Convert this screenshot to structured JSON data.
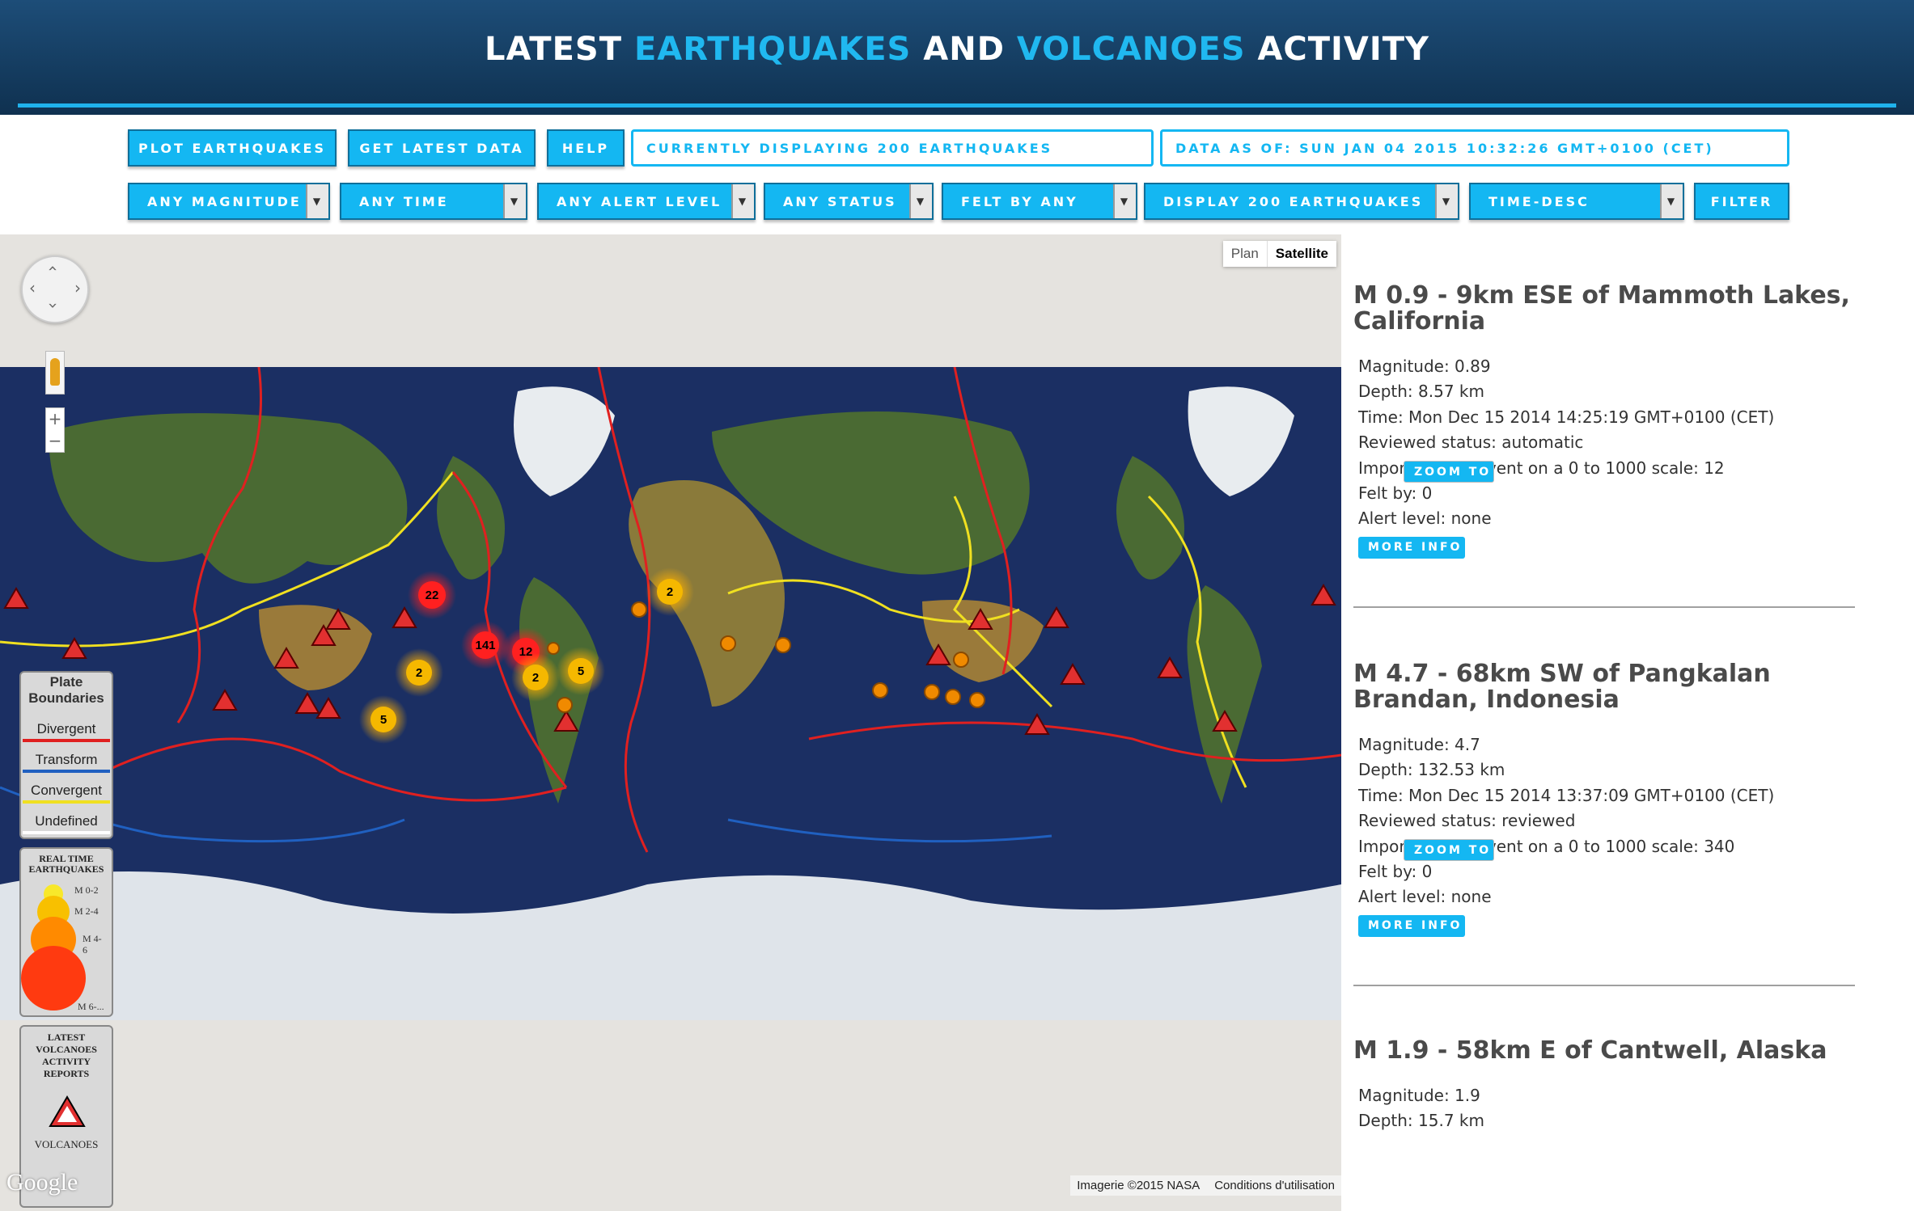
{
  "header": {
    "title_part1": "LATEST",
    "title_part2": "EARTHQUAKES",
    "title_part3": "AND",
    "title_part4": "VOLCANOES",
    "title_part5": "ACTIVITY"
  },
  "toolbar": {
    "plot_label": "PLOT EARTHQUAKES",
    "latest_label": "GET LATEST DATA",
    "help_label": "HELP",
    "displaying_text": "CURRENTLY DISPLAYING 200 EARTHQUAKES",
    "data_as_of_text": "DATA AS OF: SUN JAN 04 2015 10:32:26 GMT+0100 (CET)"
  },
  "filters": {
    "magnitude": "ANY MAGNITUDE",
    "time": "ANY TIME",
    "alert": "ANY ALERT LEVEL",
    "status": "ANY STATUS",
    "felt": "FELT BY ANY",
    "display": "DISPLAY 200 EARTHQUAKES",
    "order": "TIME-DESC",
    "filter_label": "FILTER"
  },
  "map": {
    "type_plan": "Plan",
    "type_satellite": "Satellite",
    "selected_type": "Satellite",
    "attribution_imagery": "Imagerie ©2015 NASA",
    "attribution_terms": "Conditions d'utilisation",
    "google_logo": "Google",
    "plate_legend": {
      "title_line1": "Plate",
      "title_line2": "Boundaries",
      "items": [
        {
          "label": "Divergent",
          "color": "#e02020"
        },
        {
          "label": "Transform",
          "color": "#2060c0"
        },
        {
          "label": "Convergent",
          "color": "#f0e020"
        },
        {
          "label": "Undefined",
          "color": "#ffffff"
        }
      ]
    },
    "eq_legend": {
      "title_line1": "REAL TIME",
      "title_line2": "EARTHQUAKES",
      "m1": "M 0-2",
      "m2": "M 2-4",
      "m3a": "M 4-",
      "m3b": "6",
      "m4": "M 6-..."
    },
    "vol_legend": {
      "title_line1": "LATEST",
      "title_line2": "VOLCANOES",
      "title_line3": "ACTIVITY",
      "title_line4": "REPORTS",
      "label": "VOLCANOES"
    },
    "clusters": [
      {
        "count": "22",
        "color": "red"
      },
      {
        "count": "141",
        "color": "red"
      },
      {
        "count": "12",
        "color": "red"
      },
      {
        "count": "2",
        "color": "orange"
      },
      {
        "count": "2",
        "color": "orange"
      },
      {
        "count": "5",
        "color": "orange"
      },
      {
        "count": "2",
        "color": "orange"
      },
      {
        "count": "5",
        "color": "orange"
      }
    ]
  },
  "feed": {
    "zoom_label": "ZOOM TO",
    "more_label": "MORE INFO",
    "items": [
      {
        "title": "M 0.9 - 9km ESE of Mammoth Lakes, California",
        "magnitude": "Magnitude: 0.89",
        "depth": "Depth: 8.57 km",
        "time": "Time: Mon Dec 15 2014 14:25:19 GMT+0100 (CET)",
        "status": "Reviewed status: automatic",
        "importance": "Importance of event on a 0 to 1000 scale: 12",
        "felt": "Felt by: 0",
        "alert": "Alert level: none"
      },
      {
        "title": "M 4.7 - 68km SW of Pangkalan Brandan, Indonesia",
        "magnitude": "Magnitude: 4.7",
        "depth": "Depth: 132.53 km",
        "time": "Time: Mon Dec 15 2014 13:37:09 GMT+0100 (CET)",
        "status": "Reviewed status: reviewed",
        "importance": "Importance of event on a 0 to 1000 scale: 340",
        "felt": "Felt by: 0",
        "alert": "Alert level: none"
      },
      {
        "title": "M 1.9 - 58km E of Cantwell, Alaska",
        "magnitude": "Magnitude: 1.9",
        "depth": "Depth: 15.7 km"
      }
    ]
  }
}
